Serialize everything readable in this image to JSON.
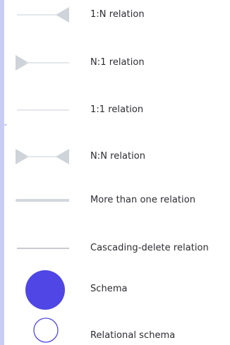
{
  "legend": {
    "items": [
      {
        "symbol": "one-to-many-arrow-icon",
        "label": "1:N relation"
      },
      {
        "symbol": "many-to-one-arrow-icon",
        "label": "N:1 relation"
      },
      {
        "symbol": "one-to-one-line-icon",
        "label": "1:1 relation"
      },
      {
        "symbol": "many-to-many-arrow-icon",
        "label": "N:N relation"
      },
      {
        "symbol": "thick-line-icon",
        "label": "More than one relation"
      },
      {
        "symbol": "dark-line-icon",
        "label": "Cascading-delete relation"
      },
      {
        "symbol": "filled-circle-icon",
        "label": "Schema"
      },
      {
        "symbol": "outline-circle-icon",
        "label": "Relational schema"
      }
    ]
  },
  "colors": {
    "line": "#dcdfe5",
    "line_dark": "#b7bac0",
    "line_thick": "#d3d7df",
    "arrow": "#cfd3da",
    "schema": "#4f46e5",
    "accent": "#c9cdf6",
    "text": "#2c2c33"
  }
}
